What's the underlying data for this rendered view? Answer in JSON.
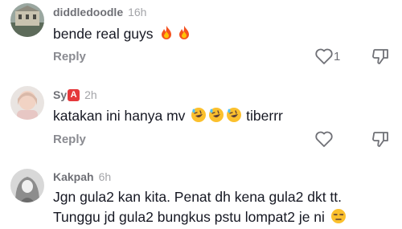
{
  "comments": [
    {
      "username": "diddledoodle",
      "time": "16h",
      "text": "bende real guys",
      "emojis": [
        "fire-emoji",
        "fire-emoji"
      ],
      "reply_label": "Reply",
      "like_count": "1"
    },
    {
      "username": "Sy",
      "username_badge": "A",
      "time": "2h",
      "text": "katakan ini hanya mv",
      "emojis": [
        "rolling-on-floor-laughing-emoji",
        "rolling-on-floor-laughing-emoji",
        "rolling-on-floor-laughing-emoji"
      ],
      "text_after": "tiberrr",
      "reply_label": "Reply",
      "like_count": ""
    },
    {
      "username": "Kakpah",
      "time": "6h",
      "line1": "Jgn gula2 kan kita. Penat dh kena gula2 dkt tt.",
      "line2": "Tunggu jd gula2 bungkus pstu lompat2 je ni",
      "emojis": [
        "unamused-face-emoji"
      ]
    }
  ],
  "colors": {
    "username": "#6f7076",
    "timestamp": "#a3a4a8",
    "body_text": "#161823",
    "reply": "#8a8b91",
    "badge": "#e5383b"
  },
  "icons": {
    "like": "heart-outline-icon",
    "dislike": "thumbs-down-outline-icon"
  }
}
